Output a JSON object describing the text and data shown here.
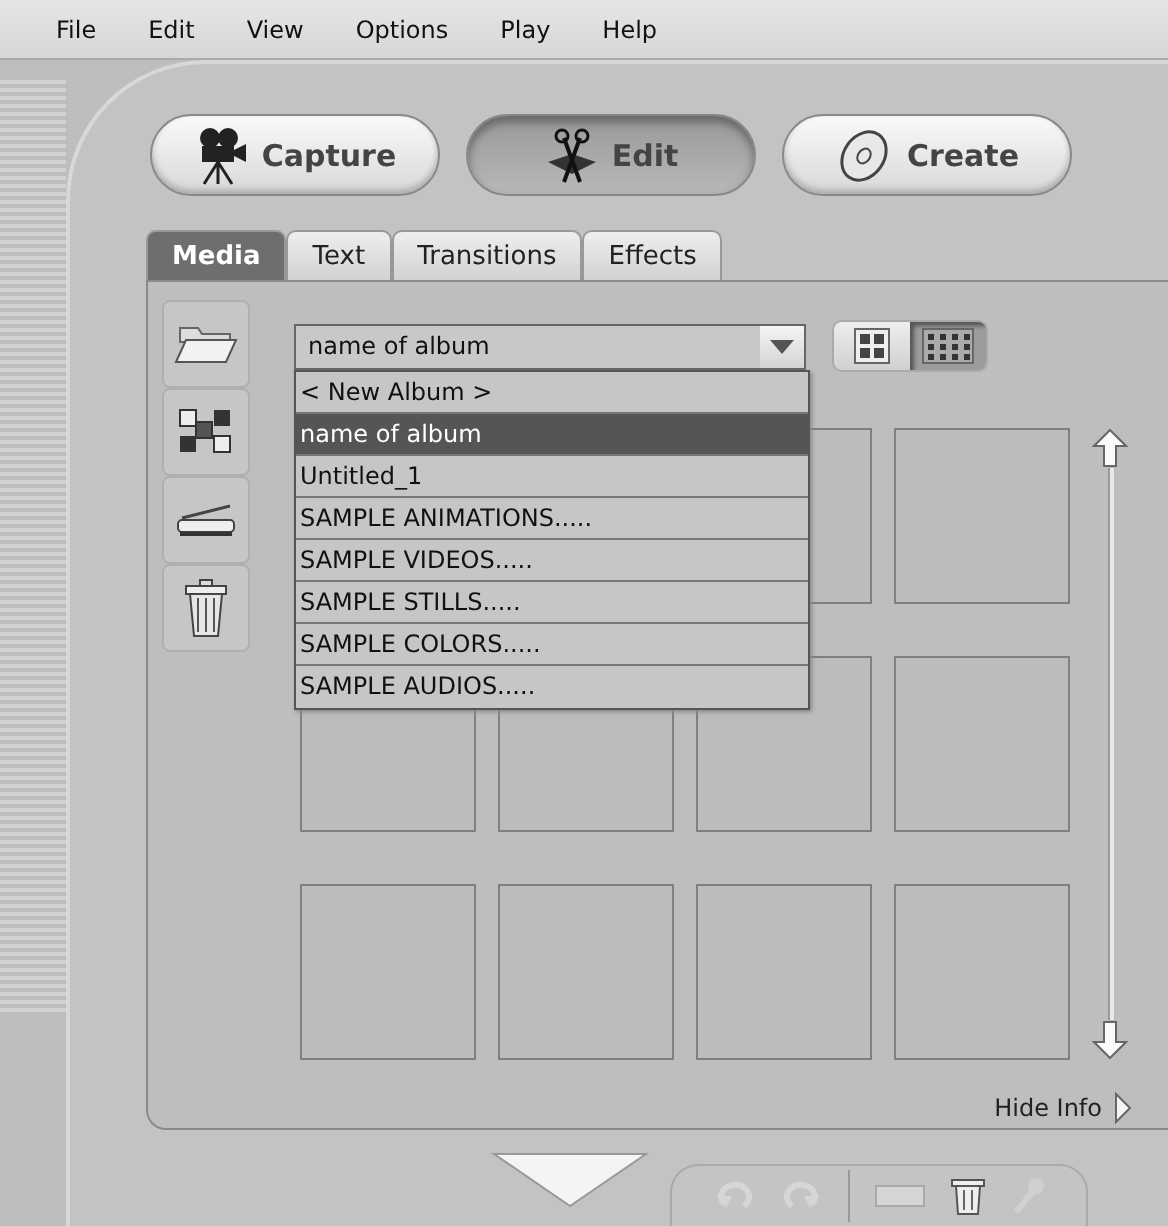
{
  "menu": [
    {
      "label": "File"
    },
    {
      "label": "Edit"
    },
    {
      "label": "View"
    },
    {
      "label": "Options"
    },
    {
      "label": "Play"
    },
    {
      "label": "Help"
    }
  ],
  "mode_buttons": [
    {
      "label": "Capture",
      "kind": "capture",
      "selected": false
    },
    {
      "label": "Edit",
      "kind": "edit",
      "selected": true
    },
    {
      "label": "Create",
      "kind": "create",
      "selected": false
    }
  ],
  "tabs": [
    {
      "label": "Media",
      "selected": true
    },
    {
      "label": "Text",
      "selected": false
    },
    {
      "label": "Transitions",
      "selected": false
    },
    {
      "label": "Effects",
      "selected": false
    }
  ],
  "album_dropdown": {
    "value": "name of album",
    "expanded": true,
    "options": [
      {
        "label": "< New Album >",
        "selected": false
      },
      {
        "label": "name of album",
        "selected": true
      },
      {
        "label": "Untitled_1",
        "selected": false
      },
      {
        "label": "SAMPLE ANIMATIONS.....",
        "selected": false
      },
      {
        "label": "SAMPLE VIDEOS.....",
        "selected": false
      },
      {
        "label": "SAMPLE STILLS.....",
        "selected": false
      },
      {
        "label": "SAMPLE COLORS.....",
        "selected": false
      },
      {
        "label": "SAMPLE AUDIOS.....",
        "selected": false
      }
    ]
  },
  "view_buttons": [
    {
      "kind": "large",
      "selected": false
    },
    {
      "kind": "small",
      "selected": true
    }
  ],
  "hide_info": {
    "label": "Hide Info"
  }
}
